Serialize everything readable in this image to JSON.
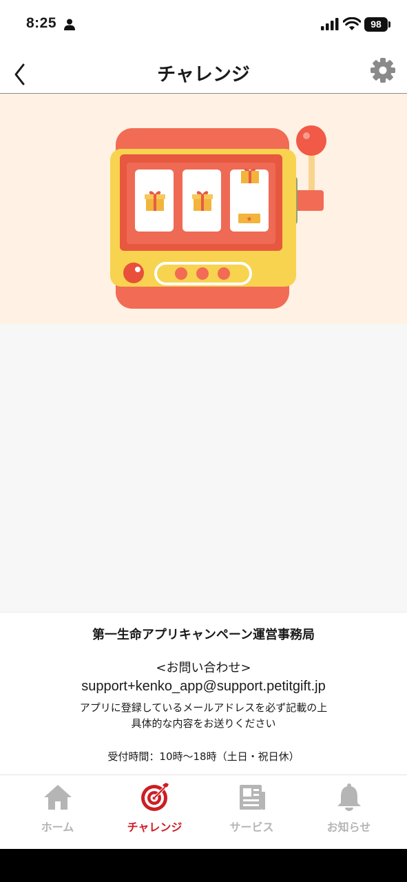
{
  "status": {
    "time": "8:25",
    "battery": "98",
    "icons": [
      "person-icon",
      "signal-icon",
      "wifi-icon",
      "battery-icon"
    ]
  },
  "nav": {
    "title": "チャレンジ",
    "back_icon": "chevron-left-icon",
    "settings_icon": "gear-icon"
  },
  "hero": {
    "illustration": "slot-machine",
    "colors": {
      "background": "#fff1e3",
      "body": "#f26b54",
      "frame": "#f7d350",
      "reel": "#ffffff",
      "gift": "#f2b43b"
    }
  },
  "footer": {
    "office": "第一生命アプリキャンペーン運営事務局",
    "inquiry_heading": "<お問い合わせ>",
    "email": "support+kenko_app@support.petitgift.jp",
    "note_line1": "アプリに登録しているメールアドレスを必ず記載の上",
    "note_line2": "具体的な内容をお送りください",
    "hours": "受付時間：10時〜18時（土日・祝日休）"
  },
  "tabs": [
    {
      "label": "ホーム",
      "icon": "home-icon",
      "active": false
    },
    {
      "label": "チャレンジ",
      "icon": "target-icon",
      "active": true
    },
    {
      "label": "サービス",
      "icon": "newspaper-icon",
      "active": false
    },
    {
      "label": "お知らせ",
      "icon": "bell-icon",
      "active": false
    }
  ],
  "colors": {
    "accent": "#cc1e24",
    "inactive": "#b5b5b5"
  }
}
